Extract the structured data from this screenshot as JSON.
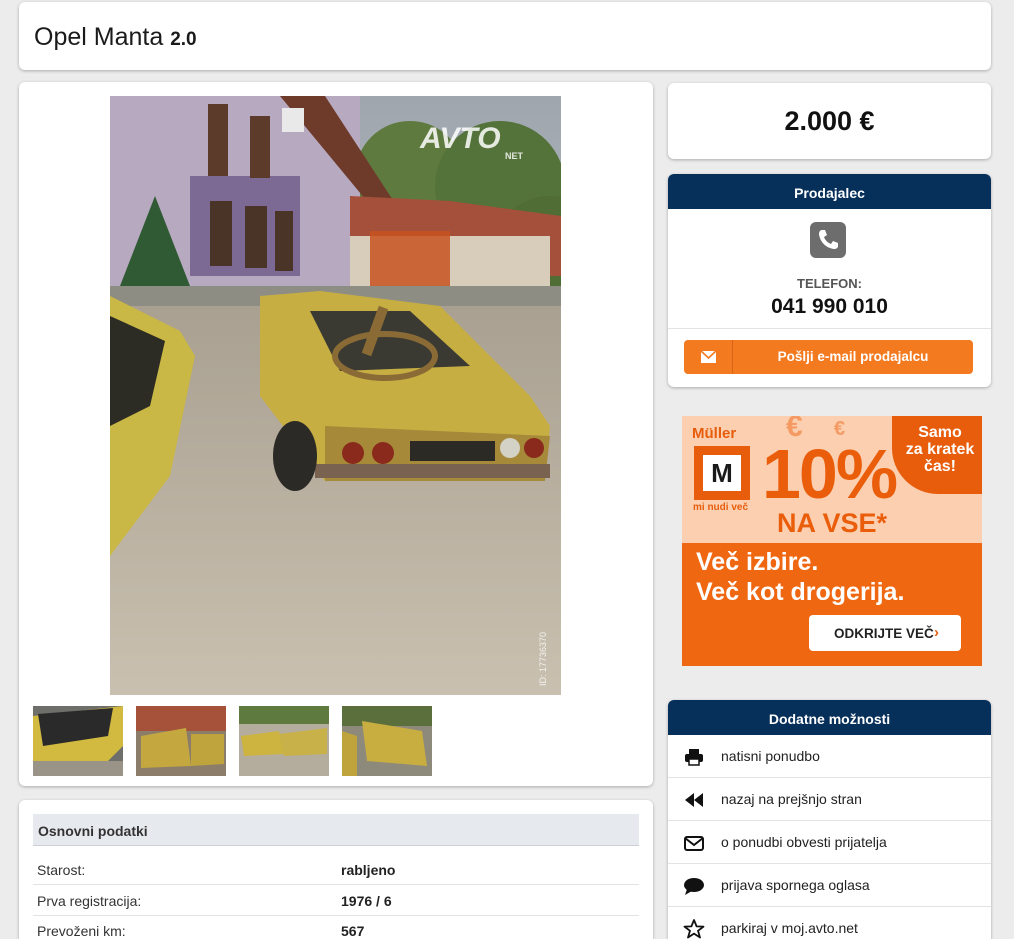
{
  "listing": {
    "title": "Opel Manta",
    "engine": "2.0",
    "price": "2.000 €"
  },
  "gallery": {
    "watermark": "AVTO",
    "watermark_suffix": "NET",
    "photo_id": "ID: 17736370",
    "thumbnail_count": 4
  },
  "seller": {
    "header": "Prodajalec",
    "phone_label": "TELEFON:",
    "phone_number": "041 990 010",
    "email_button": "Pošlji e-mail prodajalcu",
    "icons": {
      "phone": "phone-icon",
      "email": "envelope-icon"
    }
  },
  "basic_data": {
    "header": "Osnovni podatki",
    "rows": [
      {
        "label": "Starost:",
        "value": "rabljeno"
      },
      {
        "label": "Prva registracija:",
        "value": "1976 / 6"
      },
      {
        "label": "Prevoženi km:",
        "value": "567"
      }
    ]
  },
  "ad": {
    "brand": "Müller",
    "logo_letter": "M",
    "tagline": "mi nudi več",
    "euro": "€",
    "discount": "10%",
    "discount_sub": "NA VSE*",
    "badge_line1": "Samo",
    "badge_line2": "za kratek",
    "badge_line3": "čas!",
    "line1": "Več izbire.",
    "line2": "Več kot drogerija.",
    "cta": "ODKRIJTE VEČ",
    "cta_arrow": "›",
    "colors": {
      "orange": "#f06712",
      "peach": "#fbcfb0"
    }
  },
  "more_options": {
    "header": "Dodatne možnosti",
    "items": [
      {
        "label": "natisni ponudbo",
        "icon": "printer-icon"
      },
      {
        "label": "nazaj na prejšnjo stran",
        "icon": "rewind-icon"
      },
      {
        "label": "o ponudbi obvesti prijatelja",
        "icon": "envelope-icon"
      },
      {
        "label": "prijava spornega oglasa",
        "icon": "comment-icon"
      },
      {
        "label": "parkiraj v moj.avto.net",
        "icon": "star-icon"
      }
    ]
  },
  "colors": {
    "navy_header": "#062f5a",
    "orange_button": "#f47a20",
    "page_bg": "#ececec"
  }
}
